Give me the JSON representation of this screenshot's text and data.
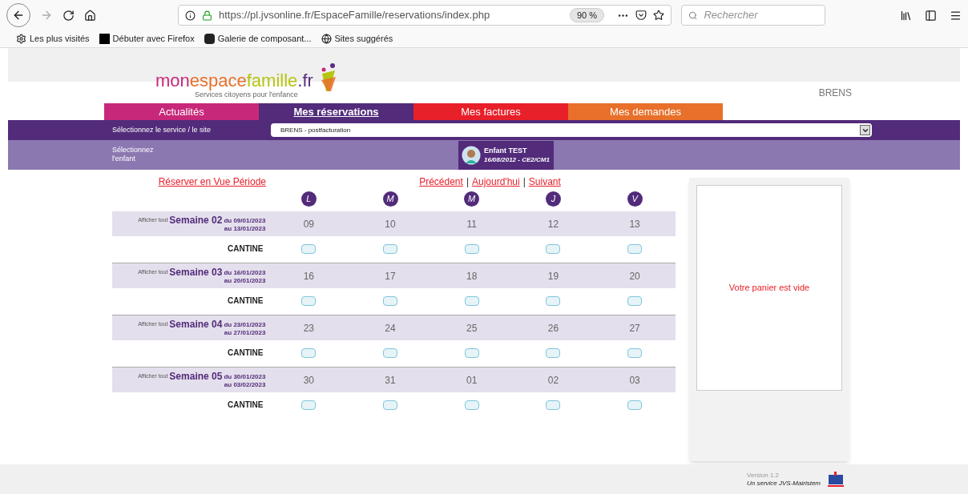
{
  "browser": {
    "url": "https://pl.jvsonline.fr/EspaceFamille/reservations/index.php",
    "zoom": "90 %",
    "search_placeholder": "Rechercher",
    "bookmarks": [
      {
        "label": "Les plus visités",
        "kind": "gear"
      },
      {
        "label": "Débuter avec Firefox",
        "kind": "m"
      },
      {
        "label": "Galerie de composant...",
        "kind": "gallery"
      },
      {
        "label": "Sites suggérés",
        "kind": "globe"
      }
    ]
  },
  "logo": {
    "parts": [
      {
        "text": "mon",
        "color": "#c8287a"
      },
      {
        "text": "espace",
        "color": "#e8702a"
      },
      {
        "text": "famille",
        "color": "#b5c512"
      },
      {
        "text": ".fr",
        "color": "#5a2d82"
      }
    ],
    "tagline": "Services citoyens pour l'enfance"
  },
  "commune": "BRENS",
  "tabs": [
    {
      "label": "Actualités",
      "color": "#c8287a",
      "selected": false
    },
    {
      "label": "Mes réservations",
      "color": "#522b7a",
      "selected": true
    },
    {
      "label": "Mes factures",
      "color": "#e8202a",
      "selected": false
    },
    {
      "label": "Mes demandes",
      "color": "#e8702a",
      "selected": false
    }
  ],
  "service": {
    "label": "Sélectionnez le service / le site",
    "value": "BRENS - postfacturation"
  },
  "child_select": {
    "label": "Sélectionnez\nl'enfant",
    "name": "Enfant TEST",
    "details": "16/08/2012 - CE2/CM1"
  },
  "nav": {
    "period_link": "Réserver en Vue Période",
    "links": [
      "Précédent",
      "Aujourd'hui",
      "Suivant"
    ],
    "separator": "|"
  },
  "weekdays": [
    "L",
    "M",
    "M",
    "J",
    "V"
  ],
  "weeks": [
    {
      "show_all": "Afficher tout",
      "title": "Semaine 02",
      "from": "du 09/01/2023",
      "to": "au 13/01/2023",
      "days": [
        "09",
        "10",
        "11",
        "12",
        "13"
      ],
      "service": "CANTINE",
      "slots": [
        {
          "checked": false
        },
        {
          "checked": false
        },
        {
          "checked": false
        },
        {
          "checked": false
        },
        {
          "checked": false
        }
      ]
    },
    {
      "show_all": "Afficher tout",
      "title": "Semaine 03",
      "from": "du 16/01/2023",
      "to": "au 20/01/2023",
      "days": [
        "16",
        "17",
        "18",
        "19",
        "20"
      ],
      "service": "CANTINE",
      "slots": [
        {
          "checked": false
        },
        {
          "checked": false
        },
        {
          "checked": false
        },
        {
          "checked": false
        },
        {
          "checked": false
        }
      ]
    },
    {
      "show_all": "Afficher tout",
      "title": "Semaine 04",
      "from": "du 23/01/2023",
      "to": "au 27/01/2023",
      "days": [
        "23",
        "24",
        "25",
        "26",
        "27"
      ],
      "service": "CANTINE",
      "slots": [
        {
          "checked": false
        },
        {
          "checked": false
        },
        {
          "checked": false
        },
        {
          "checked": false
        },
        {
          "checked": false
        }
      ]
    },
    {
      "show_all": "Afficher tout",
      "title": "Semaine 05",
      "from": "du 30/01/2023",
      "to": "au 03/02/2023",
      "days": [
        "30",
        "31",
        "01",
        "02",
        "03"
      ],
      "service": "CANTINE",
      "slots": [
        {
          "checked": false
        },
        {
          "checked": false
        },
        {
          "checked": false
        },
        {
          "checked": false
        },
        {
          "checked": false
        }
      ]
    }
  ],
  "cart": {
    "empty_message": "Votre panier est vide"
  },
  "footer": {
    "version": "Version 1.2",
    "credit": "Un service JVS-Mairistem"
  }
}
